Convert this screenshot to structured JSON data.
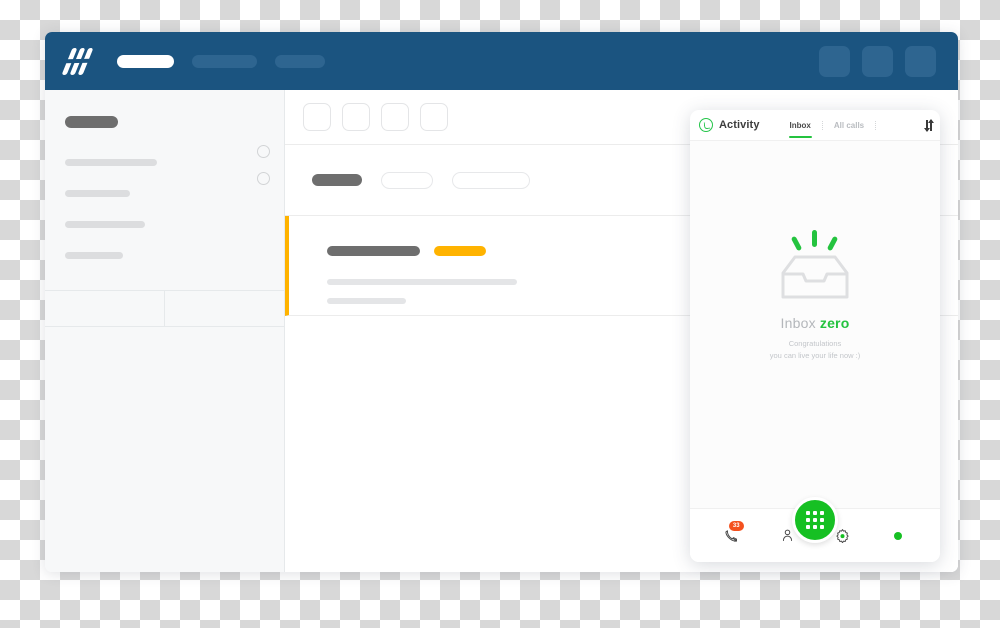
{
  "window": {
    "header": {
      "logo_name": "brand-logo",
      "nav_items": [
        {
          "label": "",
          "state": "active"
        },
        {
          "label": "",
          "state": "dim"
        },
        {
          "label": "",
          "state": "dim"
        }
      ],
      "action_buttons": [
        "",
        "",
        ""
      ]
    },
    "sidebar": {
      "title_placeholder": "",
      "items": [
        "",
        "",
        "",
        ""
      ],
      "toggle_circles": 2,
      "footer_cells": [
        "",
        ""
      ]
    },
    "main": {
      "tiles": [
        "",
        "",
        "",
        ""
      ],
      "filter_label": "",
      "filter_chips": [
        "",
        ""
      ],
      "record": {
        "title": "",
        "tag": "",
        "accent_color": "#ffb300",
        "lines": [
          "",
          ""
        ]
      }
    }
  },
  "activity_panel": {
    "brand": "Activity",
    "logo_icon": "phone-circle-icon",
    "tabs": [
      {
        "label": "Inbox",
        "active": true
      },
      {
        "label": "All calls",
        "active": false
      }
    ],
    "sort_icon": "sort-arrows-icon",
    "empty_state": {
      "illustration": "inbox-tray-icon",
      "title_prefix": "Inbox ",
      "title_accent": "zero",
      "subtitle_line1": "Congratulations",
      "subtitle_line2": "you can live your life now :)"
    },
    "footer": {
      "calls": {
        "icon": "phone-missed-icon",
        "badge": "33",
        "badge_color": "#f4511e"
      },
      "contacts": {
        "icon": "person-icon"
      },
      "dialpad": {
        "icon": "dialpad-icon",
        "color": "#16c023"
      },
      "settings": {
        "icon": "gear-icon"
      },
      "status": {
        "icon": "status-dot-icon",
        "color": "#16c023"
      }
    }
  },
  "theme": {
    "header_blue": "#1b5480",
    "accent_orange": "#ffb300",
    "accent_green": "#24c33f"
  }
}
